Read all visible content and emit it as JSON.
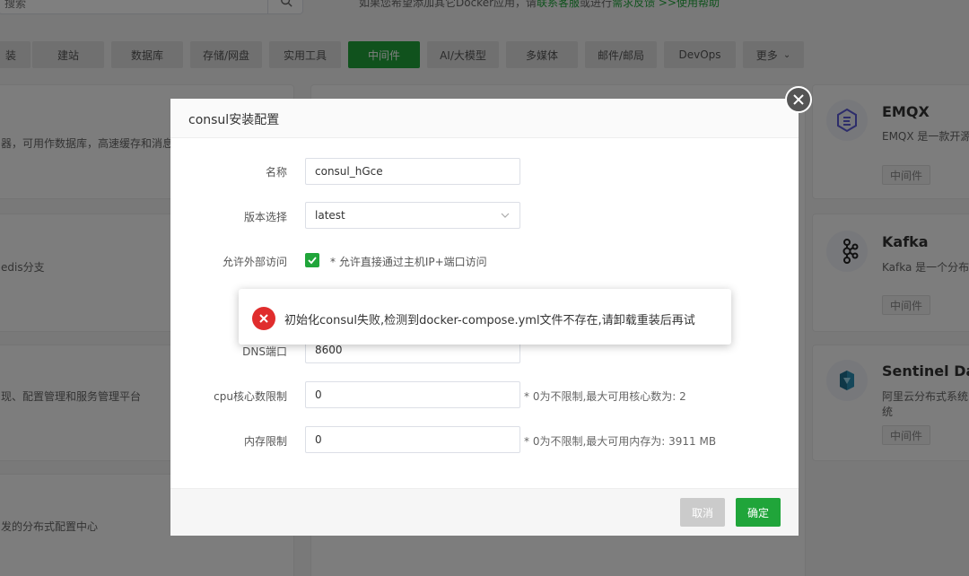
{
  "background": {
    "search": {
      "placeholder": "搜索"
    },
    "hint": {
      "prefix": "如果您希望添加其它Docker应用，请",
      "link1": "联系客服",
      "middle": "或进行",
      "link2": "需求反馈",
      "suffix": " >>使用帮助"
    },
    "categories": [
      {
        "label": "装"
      },
      {
        "label": "建站"
      },
      {
        "label": "数据库"
      },
      {
        "label": "存储/网盘"
      },
      {
        "label": "实用工具"
      },
      {
        "label": "中间件",
        "active": true
      },
      {
        "label": "AI/大模型"
      },
      {
        "label": "多媒体"
      },
      {
        "label": "邮件/邮局"
      },
      {
        "label": "DevOps"
      },
      {
        "label": "更多"
      }
    ],
    "left_cards": [
      {
        "desc": "器，可用作数据库，高速缓存和消息"
      },
      {
        "desc": "edis分支"
      },
      {
        "desc": "现、配置管理和服务管理平台"
      },
      {
        "desc": "发的分布式配置中心"
      }
    ],
    "right_cards": [
      {
        "title": "EMQX",
        "desc": "EMQX 是一款开源",
        "tag": "中间件",
        "icon": "emqx-logo-icon"
      },
      {
        "title": "Kafka",
        "desc": "Kafka 是一个分布式",
        "tag": "中间件",
        "icon": "kafka-logo-icon"
      },
      {
        "title": "Sentinel Dash",
        "desc": "阿里云分布式系统",
        "desc2": "统",
        "tag": "中间件",
        "icon": "sentinel-logo-icon"
      }
    ]
  },
  "dialog": {
    "title": "consul安装配置",
    "fields": {
      "name_label": "名称",
      "name_value": "consul_hGce",
      "version_label": "版本选择",
      "version_value": "latest",
      "external_label": "允许外部访问",
      "external_note": "* 允许直接通过主机IP+端口访问",
      "external_checked": true,
      "dns_label": "DNS端口",
      "dns_value": "8600",
      "cpu_label": "cpu核心数限制",
      "cpu_value": "0",
      "cpu_note": "* 0为不限制,最大可用核心数为: 2",
      "mem_label": "内存限制",
      "mem_value": "0",
      "mem_note": "* 0为不限制,最大可用内存为: 3911 MB"
    },
    "buttons": {
      "cancel": "取消",
      "ok": "确定"
    }
  },
  "toast": {
    "message": "初始化consul失败,检测到docker-compose.yml文件不存在,请卸载重装后再试",
    "icon": "error-icon",
    "color": "#e02d2d"
  },
  "colors": {
    "accent": "#20a53a",
    "error": "#e02d2d"
  }
}
